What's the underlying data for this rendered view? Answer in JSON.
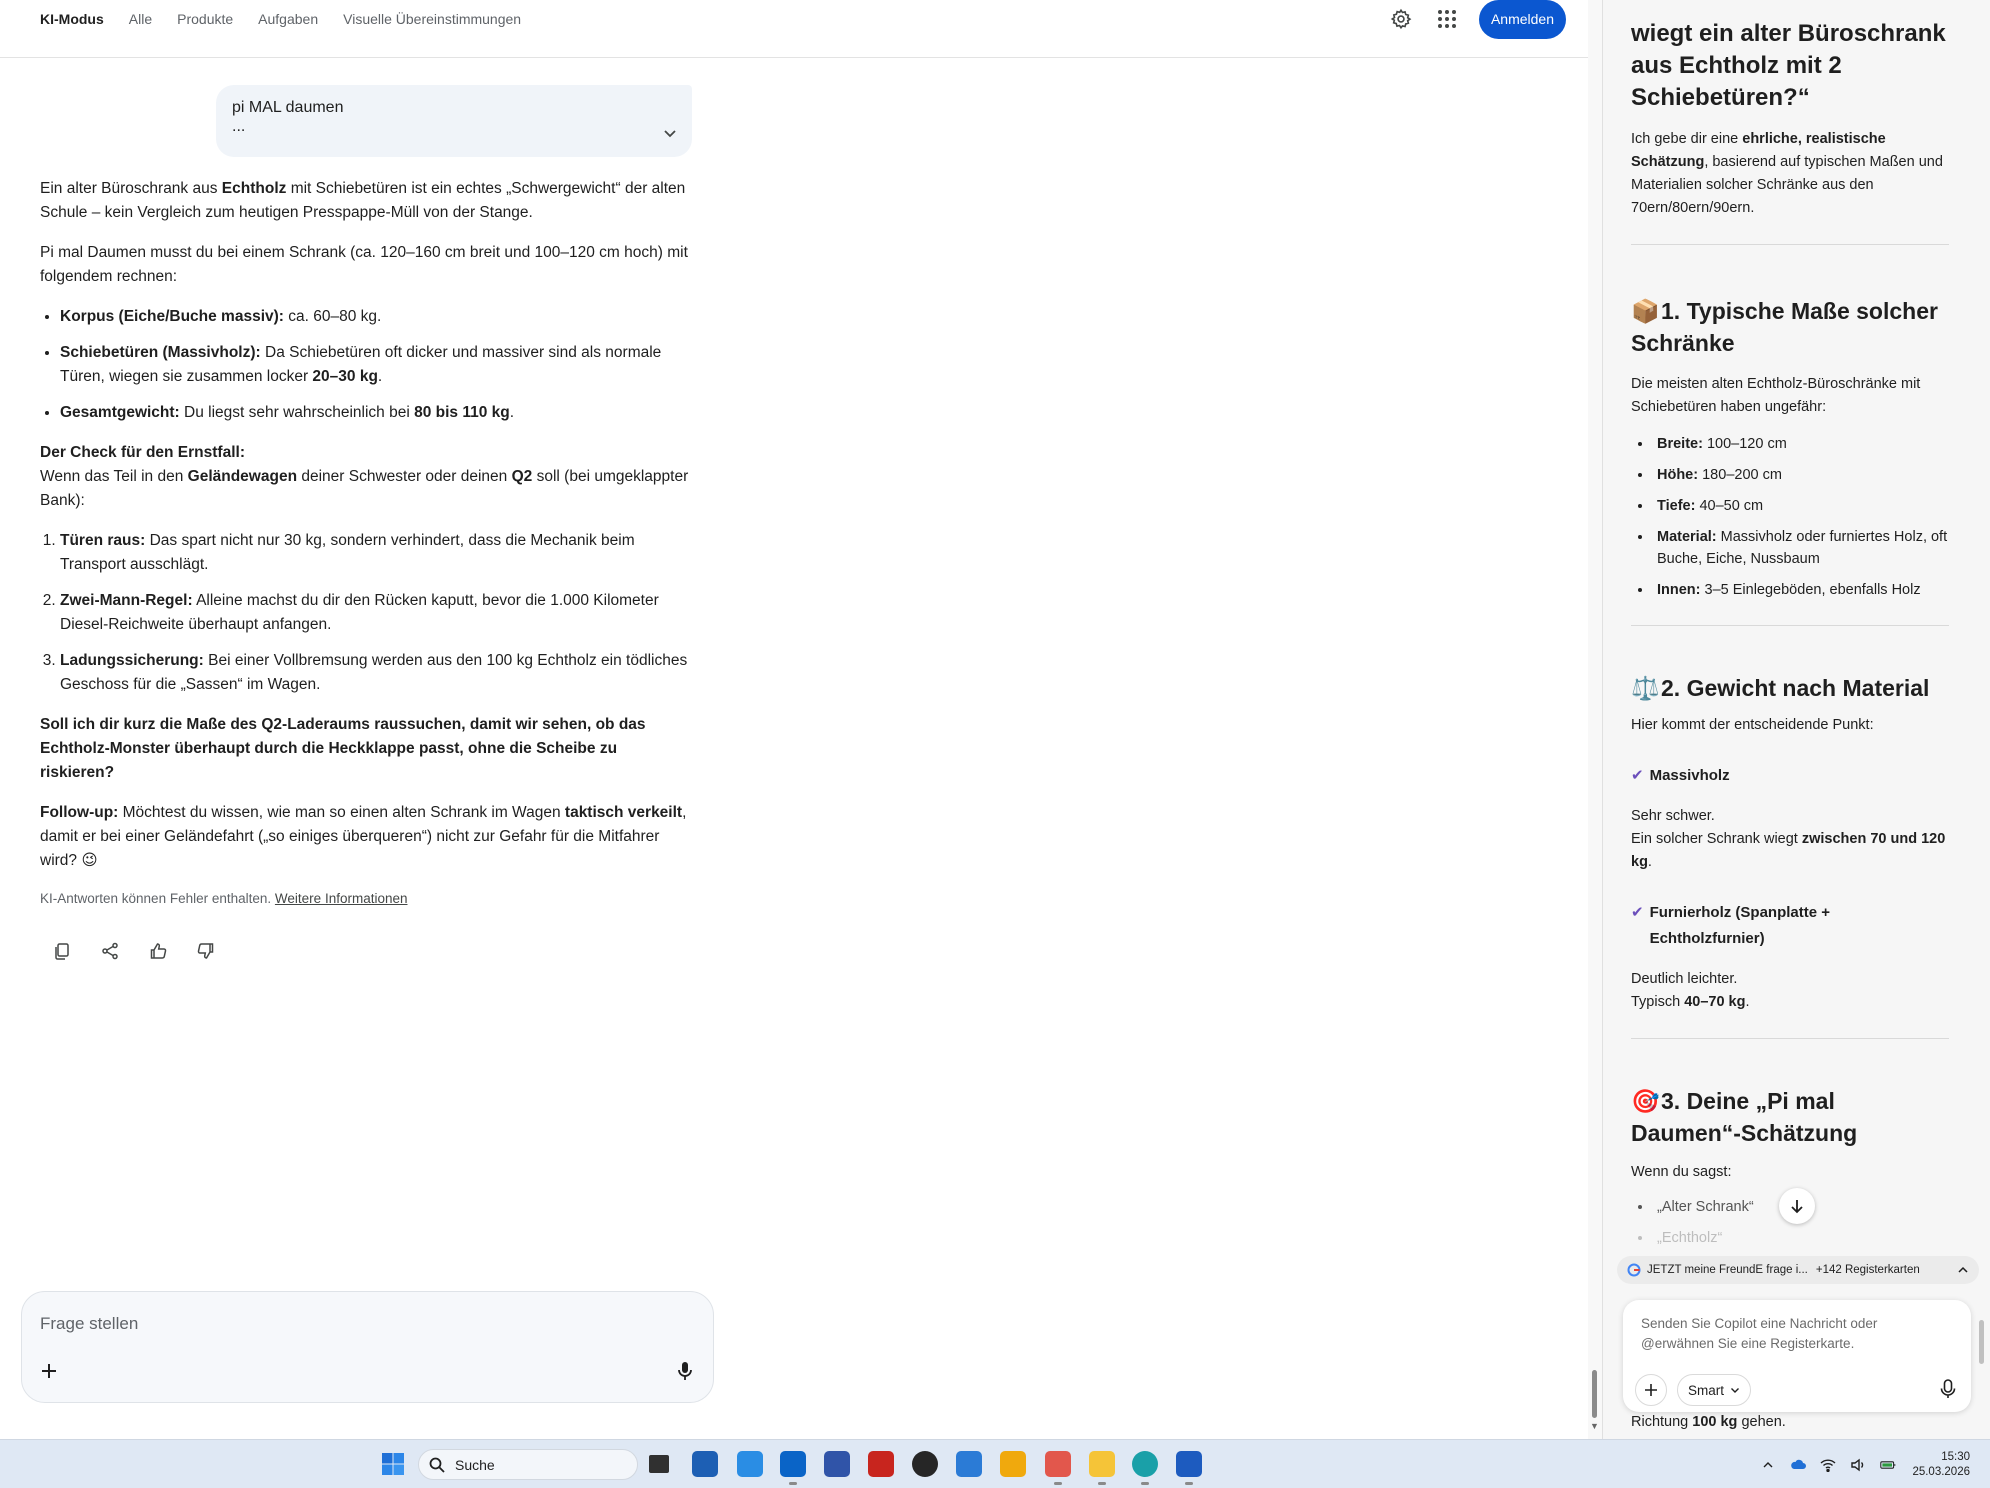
{
  "nav": {
    "tabs": [
      "KI-Modus",
      "Alle",
      "Produkte",
      "Aufgaben",
      "Visuelle Übereinstimmungen"
    ],
    "signin_label": "Anmelden"
  },
  "user_message": {
    "text": "pi MAL daumen",
    "more": "..."
  },
  "answer": {
    "intro_a": "Ein alter Büroschrank aus ",
    "intro_b": "Echtholz",
    "intro_c": " mit Schiebetüren ist ein echtes „Schwergewicht“ der alten Schule – kein Vergleich zum heutigen Presspappe-Müll von der Stange.",
    "p2": "Pi mal Daumen musst du bei einem Schrank (ca. 120–160 cm breit und 100–120 cm hoch) mit folgendem rechnen:",
    "bullet1_b": "Korpus (Eiche/Buche massiv):",
    "bullet1_t": " ca. 60–80 kg.",
    "bullet2_b": "Schiebetüren (Massivholz):",
    "bullet2_t": " Da Schiebetüren oft dicker und massiver sind als normale Türen, wiegen sie zusammen locker ",
    "bullet2_b2": "20–30 kg",
    "bullet2_t2": ".",
    "bullet3_b": "Gesamtgewicht:",
    "bullet3_t": " Du liegst sehr wahrscheinlich bei ",
    "bullet3_b2": "80 bis 110 kg",
    "bullet3_t2": ".",
    "check_title": "Der Check für den Ernstfall:",
    "check_a": "Wenn das Teil in den ",
    "check_b": "Geländewagen",
    "check_c": " deiner Schwester oder deinen ",
    "check_d": "Q2",
    "check_e": " soll (bei umgeklappter Bank):",
    "step1_b": "Türen raus:",
    "step1_t": " Das spart nicht nur 30 kg, sondern verhindert, dass die Mechanik beim Transport ausschlägt.",
    "step2_b": "Zwei-Mann-Regel:",
    "step2_t": " Alleine machst du dir den Rücken kaputt, bevor die 1.000 Kilometer Diesel-Reichweite überhaupt anfangen.",
    "step3_b": "Ladungssicherung:",
    "step3_t": " Bei einer Vollbremsung werden aus den 100 kg Echtholz ein tödliches Geschoss für die „Sassen“ im Wagen.",
    "question": "Soll ich dir kurz die Maße des Q2-Laderaums raussuchen, damit wir sehen, ob das Echtholz-Monster überhaupt durch die Heckklappe passt, ohne die Scheibe zu riskieren?",
    "followup_b": "Follow-up:",
    "followup_a": " Möchtest du wissen, wie man so einen alten Schrank im Wagen ",
    "followup_b2": "taktisch verkeilt",
    "followup_c": ", damit er bei einer Geländefahrt („so einiges überqueren“) nicht zur Gefahr für die Mitfahrer wird? 😉",
    "disclaimer": "KI-Antworten können Fehler enthalten.",
    "disclaimer_link": "Weitere Informationen"
  },
  "prompt": {
    "placeholder": "Frage stellen"
  },
  "copilot": {
    "heading": "wiegt ein alter Büroschrank aus Echtholz mit 2 Schiebetüren?“",
    "intro_a": "Ich gebe dir eine ",
    "intro_b": "ehrliche, realistische Schätzung",
    "intro_c": ", basierend auf typischen Maßen und Materialien solcher Schränke aus den 70ern/80ern/90ern.",
    "s1_emoji": "📦",
    "s1_title": "1. Typische Maße solcher Schränke",
    "s1_text": "Die meisten alten Echtholz-Büroschränke mit Schiebetüren haben ungefähr:",
    "dims": [
      {
        "k": "Breite:",
        "v": " 100–120 cm"
      },
      {
        "k": "Höhe:",
        "v": " 180–200 cm"
      },
      {
        "k": "Tiefe:",
        "v": " 40–50 cm"
      },
      {
        "k": "Material:",
        "v": " Massivholz oder furniertes Holz, oft Buche, Eiche, Nussbaum"
      },
      {
        "k": "Innen:",
        "v": " 3–5 Einlegeböden, ebenfalls Holz"
      }
    ],
    "s2_emoji": "⚖️",
    "s2_title": "2. Gewicht nach Material",
    "s2_text": "Hier kommt der entscheidende Punkt:",
    "m1_title": "Massivholz",
    "m1_line1": "Sehr schwer.",
    "m1_line2a": "Ein solcher Schrank wiegt ",
    "m1_line2b": "zwischen 70 und 120 kg",
    "m1_line2c": ".",
    "m2_title": "Furnierholz (Spanplatte + Echtholzfurnier)",
    "m2_line1": "Deutlich leichter.",
    "m2_line2a": "Typisch ",
    "m2_line2b": "40–70 kg",
    "m2_line2c": ".",
    "s3_emoji": "🎯",
    "s3_title": "3. Deine „Pi mal Daumen“-Schätzung",
    "s3_text": "Wenn du sagst:",
    "s3_items": [
      "„Alter Schrank“",
      "„Echtholz“"
    ],
    "tab_chip_title": "JETZT meine FreundE frage i...",
    "tab_chip_count": "+142 Registerkarten",
    "input_placeholder": "Senden Sie Copilot eine Nachricht oder @erwähnen Sie eine Registerkarte.",
    "mode_label": "Smart",
    "bottom_a": "Richtung ",
    "bottom_b": "100 kg",
    "bottom_c": " gehen."
  },
  "taskbar": {
    "search_label": "Suche",
    "time": "15:30",
    "date": "25.03.2026"
  }
}
